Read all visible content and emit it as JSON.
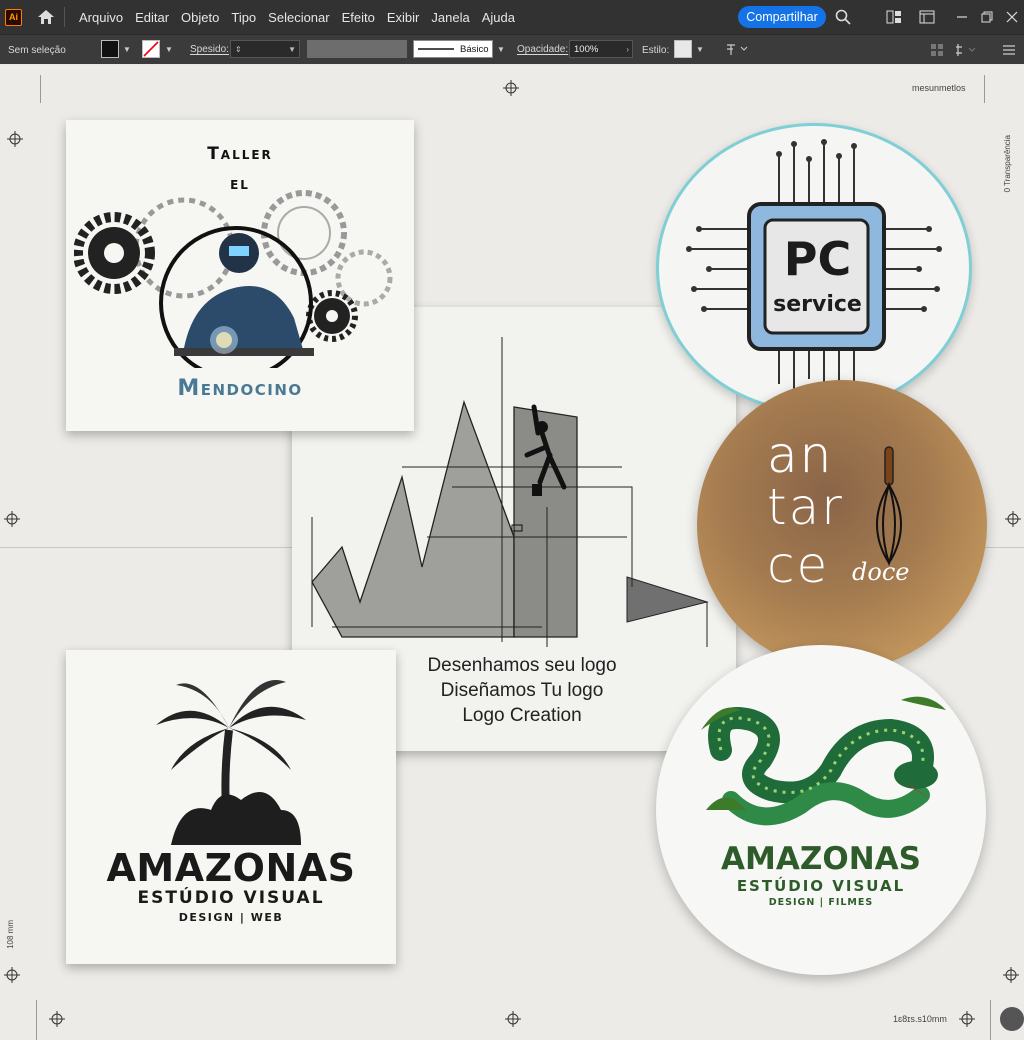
{
  "app": {
    "icon_label": "Ai"
  },
  "menu": {
    "items": [
      "Arquivo",
      "Editar",
      "Objeto",
      "Tipo",
      "Selecionar",
      "Efeito",
      "Exibir",
      "Janela",
      "Ajuda"
    ]
  },
  "share_label": "Compartilhar",
  "control_bar": {
    "selection_status": "Sem seleção",
    "stroke_weight_label": "Spesido:",
    "stroke_style_label": "Básico",
    "opacity_label": "Opacidade:",
    "opacity_value": "100%",
    "style_label": "Estilo:"
  },
  "canvas": {
    "top_right_label": "mesunmetlos",
    "right_vertical_label": "0 Transparência",
    "left_vertical_label": "108 mm",
    "bottom_right_label": "1ɛ8ɪs.s10mm"
  },
  "logos": {
    "taller": {
      "line1": "Taller",
      "line2": "el",
      "line3": "Mendocino"
    },
    "pc": {
      "line1": "PC",
      "line2": "service"
    },
    "antarce": {
      "line1": "an",
      "line2": "tar",
      "line3": "ce",
      "script": "doce"
    },
    "amazonas_square": {
      "title": "AMAZONAS",
      "subtitle": "ESTÚDIO VISUAL",
      "tagline": "DESIGN | WEB"
    },
    "amazonas_circle": {
      "title": "AMAZONAS",
      "subtitle": "ESTÚDIO VISUAL",
      "tagline": "DESIGN | FILMES"
    }
  },
  "center_text": {
    "line1": "Desenhamos seu logo",
    "line2": "Diseñamos Tu logo",
    "line3": "Logo Creation"
  },
  "colors": {
    "accent": "#1473e6",
    "menubar": "#323232",
    "antarce_bg": "#c9995a",
    "amazonas_green": "#2e5b2a",
    "taller_blue": "#4a7a93"
  }
}
